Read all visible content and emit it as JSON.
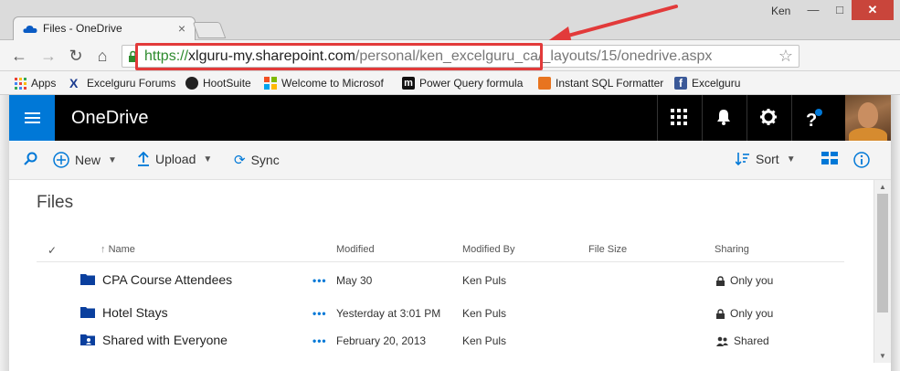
{
  "window": {
    "tab_title": "Files - OneDrive",
    "tab_close": "×",
    "user_name": "Ken",
    "minimize": "—",
    "maximize": "□",
    "close": "✕"
  },
  "toolbar": {
    "back_icon": "arrow-left-icon",
    "forward_icon": "arrow-right-icon",
    "reload_icon": "reload-icon",
    "home_icon": "home-icon",
    "url_protocol": "https://",
    "url_host": "xlguru-my.sharepoint.com",
    "url_path": "/personal/ken_excelguru_ca/_layouts/15/onedrive.aspx",
    "star": "☆",
    "annotation_color": "#e23a3a"
  },
  "bookmarks": [
    {
      "label": "Apps",
      "color": "#4285f4"
    },
    {
      "label": "Excelguru Forums",
      "color": "#1b3b8f"
    },
    {
      "label": "HootSuite",
      "color": "#222222"
    },
    {
      "label": "Welcome to Microsof",
      "color": "#f25022"
    },
    {
      "label": "Power Query formula",
      "color": "#111111"
    },
    {
      "label": "Instant SQL Formatter",
      "color": "#e8741f"
    },
    {
      "label": "Excelguru",
      "color": "#3b5998"
    }
  ],
  "suitebar": {
    "brand": "OneDrive",
    "accent": "#0078d7"
  },
  "commands": {
    "search_icon": "search-icon",
    "new_label": "New",
    "upload_label": "Upload",
    "sync_label": "Sync",
    "sort_label": "Sort"
  },
  "files": {
    "title": "Files",
    "columns": {
      "name": "Name",
      "modified": "Modified",
      "modified_by": "Modified By",
      "file_size": "File Size",
      "sharing": "Sharing"
    },
    "rows": [
      {
        "name": "CPA Course Attendees",
        "more": "•••",
        "modified": "May 30",
        "modified_by": "Ken Puls",
        "sharing": "Only you",
        "shared": false
      },
      {
        "name": "Hotel Stays",
        "more": "•••",
        "modified": "Yesterday at 3:01 PM",
        "modified_by": "Ken Puls",
        "sharing": "Only you",
        "shared": false
      },
      {
        "name": "Shared with Everyone",
        "more": "•••",
        "modified": "February 20, 2013",
        "modified_by": "Ken Puls",
        "sharing": "Shared",
        "shared": true
      }
    ]
  }
}
